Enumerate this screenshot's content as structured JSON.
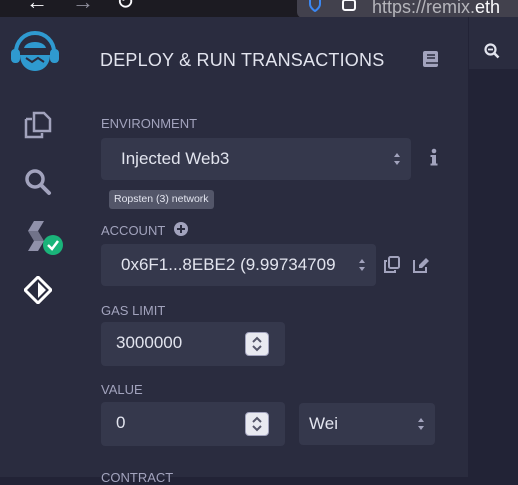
{
  "browser": {
    "back_glyph": "←",
    "forward_glyph": "→",
    "reload_glyph": "↻",
    "url_host": "https://remix.",
    "url_rest": "eth"
  },
  "sidebar": {
    "icons": [
      "remix-logo-icon",
      "file-explorer-icon",
      "search-icon",
      "solidity-compiler-icon",
      "deploy-run-icon"
    ],
    "check_color": "#1ab47a",
    "logo_color": "#2f9ad0"
  },
  "panel": {
    "title": "DEPLOY & RUN TRANSACTIONS",
    "environment": {
      "label": "ENVIRONMENT",
      "value": "Injected Web3",
      "network_badge": "Ropsten (3) network"
    },
    "account": {
      "label": "ACCOUNT",
      "value": "0x6F1...8EBE2 (9.99734709"
    },
    "gas_limit": {
      "label": "GAS LIMIT",
      "value": "3000000"
    },
    "value": {
      "label": "VALUE",
      "amount": "0",
      "unit": "Wei"
    },
    "contract": {
      "label": "CONTRACT"
    }
  },
  "colors": {
    "background": "#222336",
    "panel": "#2a2c3f",
    "field": "#35384c",
    "text": "#e2e4ee",
    "muted": "#a2a3bd"
  }
}
